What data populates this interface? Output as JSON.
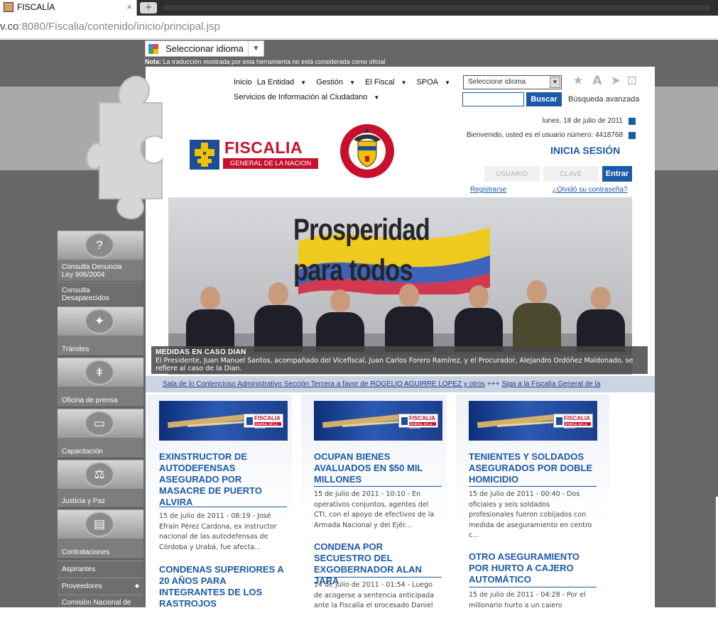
{
  "browser": {
    "tab_title": "FISCALÍA",
    "tab_close": "×",
    "new_tab": "+",
    "url_prefix": "v.co",
    "url_rest": ":8080/Fiscalia/contenido/inicio/principal.jsp"
  },
  "translate": {
    "label": "Seleccionar idioma",
    "note_bold": "Nota:",
    "note": " La traducción mostrada por esta herramienta no está considerada como oficial"
  },
  "nav": {
    "row1": [
      "Inicio",
      "La Entidad",
      "Gestión",
      "El Fiscal",
      "SPOA"
    ],
    "row2": "Servicios de Información al Ciudadano",
    "lang_select": "Seleccione idioma",
    "search_button": "Buscar",
    "advanced_search": "Búsqueda avanzada"
  },
  "header": {
    "date": "lunes, 18 de julio de 2011",
    "welcome": "Bienvenido, usted es el usuario número: 4418768",
    "login_title": "INICIA SESIÓN",
    "user_placeholder": "USUARIO",
    "pass_placeholder": "CLAVE",
    "login_button": "Entrar",
    "register": "Registrarse",
    "forgot": "¿Olvidó su contraseña?",
    "logo_name": "FISCALIA",
    "logo_sub": "GENERAL DE LA NACION",
    "seal_top": "REPÚBLICA DE COLOMBIA",
    "seal_bottom": "LIBERTAD Y ORDEN"
  },
  "sidebar": {
    "items": [
      {
        "label1": "Consulta Denuncia",
        "label2": "Ley 906/2004",
        "icon": "speech-question-icon"
      },
      {
        "label1": "Consulta",
        "label2": "Desaparecidos"
      },
      {
        "label1": "Trámites",
        "icon": "cursor-click-icon"
      },
      {
        "label1": "Oficina de prensa",
        "icon": "broadcast-antenna-icon"
      },
      {
        "label1": "Capacitación",
        "icon": "chat-bubble-icon"
      },
      {
        "label1": "Justicia y Paz",
        "icon": "scales-icon"
      },
      {
        "label1": "Contrataciones",
        "icon": "id-card-icon"
      },
      {
        "label1": "Aspirantes"
      },
      {
        "label1": "Proveedores"
      },
      {
        "label1": "Comisión Nacional de"
      }
    ]
  },
  "hero": {
    "slogan1": "Prosperidad",
    "slogan2": "para todos",
    "caption_title": "MEDIDAS EN CASO DIAN",
    "caption_text": "El Presidente, Juan Manuel Santos, acompañado del Vicefiscal, Juan Carlos Forero Ramírez, y el Procurador, Alejandro Ordóñez Maldonado, se refiere al caso de la Dian."
  },
  "ticker": {
    "item1": "Sala de lo Contencioso Administrativo Sección Tercera a favor de ROGELIO AGUIRRE LOPEZ y otros",
    "sep": "+++",
    "item2": "Siga a la Fiscalía General de la"
  },
  "news": [
    {
      "title": "EXINSTRUCTOR DE AUTODEFENSAS ASEGURADO POR MASACRE DE PUERTO ALVIRA",
      "text": "15 de julio de 2011 - 08:19 - José Efraín Pérez Cardona, ex instructor nacional de las autodefensas de Córdoba y Urabá, fue afecta...",
      "title2": "CONDENAS SUPERIORES A 20 AÑOS PARA INTEGRANTES DE LOS RASTROJOS"
    },
    {
      "title": "OCUPAN BIENES AVALUADOS EN $50 MIL MILLONES",
      "text": "15 de julio de 2011 - 10:10 - En operativos conjuntos, agentes del CTI, con el apoyo de efectivos de la Armada Nacional y del Ejér...",
      "title2": "CONDENA POR SECUESTRO DEL EXGOBERNADOR ALAN JARA",
      "text2": "14 de julio de 2011 - 01:54 - Luego de acogerse a sentencia anticipada ante la Fiscalía el procesado Daniel"
    },
    {
      "title": "TENIENTES Y SOLDADOS ASEGURADOS POR DOBLE HOMICIDIO",
      "text": "15 de julio de 2011 - 00:40 - Dos oficiales y seis soldados profesionales fueron cobijados con medida de aseguramiento en centro c...",
      "title2": "OTRO ASEGURAMIENTO POR HURTO A CAJERO AUTOMÁTICO",
      "text2": "15 de julio de 2011 - 04:28 - Por el millonario hurto a un cajero"
    }
  ],
  "colors": {
    "brand_blue": "#1b5aa8",
    "brand_red": "#c8102e"
  }
}
